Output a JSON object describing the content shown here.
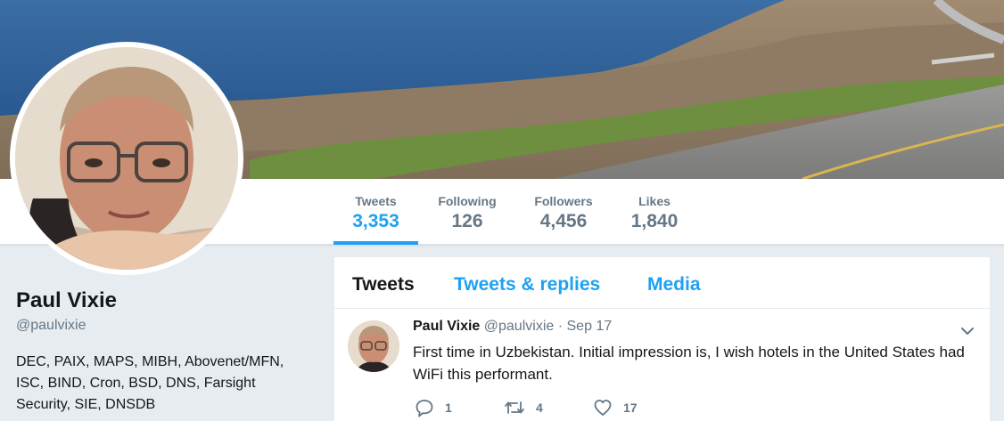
{
  "profile_nav": {
    "stats": [
      {
        "label": "Tweets",
        "value": "3,353",
        "active": true
      },
      {
        "label": "Following",
        "value": "126"
      },
      {
        "label": "Followers",
        "value": "4,456"
      },
      {
        "label": "Likes",
        "value": "1,840"
      }
    ]
  },
  "profile": {
    "name": "Paul Vixie",
    "handle": "@paulvixie",
    "bio": "DEC, PAIX, MAPS, MIBH, Abovenet/MFN, ISC, BIND, Cron, BSD, DNS, Farsight Security, SIE, DNSDB"
  },
  "timeline": {
    "tabs": [
      {
        "label": "Tweets",
        "selected": true
      },
      {
        "label": "Tweets & replies"
      },
      {
        "label": "Media"
      }
    ],
    "tweets": [
      {
        "name": "Paul Vixie",
        "handle": "@paulvixie",
        "separator": "·",
        "date": "Sep 17",
        "text": "First time in Uzbekistan. Initial impression is, I wish hotels in the United States had WiFi this performant.",
        "replies": "1",
        "retweets": "4",
        "likes": "17"
      }
    ]
  },
  "icons": {
    "reply": "reply-icon",
    "retweet": "retweet-icon",
    "like": "heart-icon",
    "menu": "chevron-down-icon"
  },
  "colors": {
    "accent": "#1da1f2",
    "muted": "#657786",
    "text": "#14171a",
    "page_bg": "#e6ecf0"
  }
}
